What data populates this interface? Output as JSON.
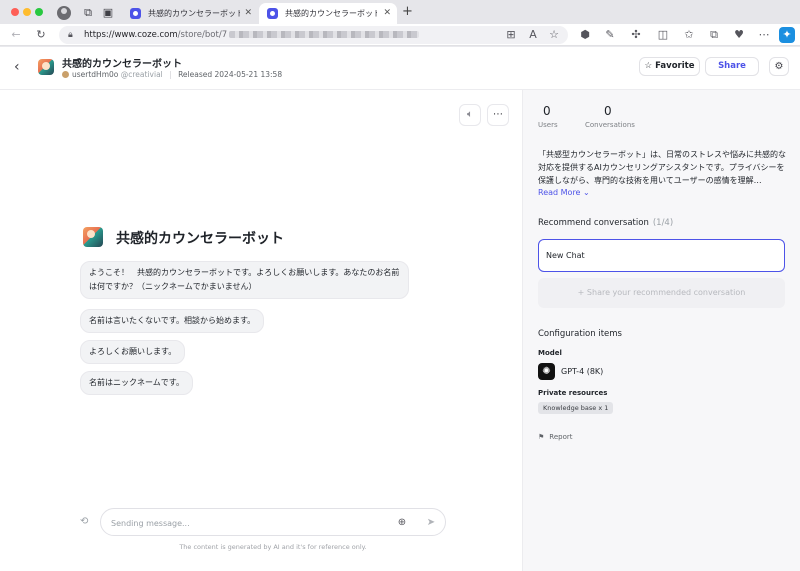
{
  "browser": {
    "tabs": [
      {
        "title": "共感的カウンセラーボット - Publi"
      },
      {
        "title": "共感的カウンセラーボット - Coze"
      }
    ],
    "url_host": "https://www.coze.com",
    "url_path": "/store/bot/7"
  },
  "header": {
    "bot_name": "共感的カウンセラーボット",
    "username": "usertdHm0o",
    "handle": "@creativial",
    "released": "Released 2024-05-21 13:58",
    "favorite_label": "Favorite",
    "share_label": "Share"
  },
  "chat": {
    "bot_name": "共感的カウンセラーボット",
    "greeting": "ようこそ！　共感的カウンセラーボットです。よろしくお願いします。あなたのお名前は何ですか？（ニックネームでかまいません）",
    "suggestions": [
      "名前は言いたくないです。相談から始めます。",
      "よろしくお願いします。",
      "名前はニックネームです。"
    ],
    "input_placeholder": "Sending message...",
    "disclaimer": "The content is generated by AI and it's for reference only."
  },
  "side": {
    "users_count": "0",
    "users_label": "Users",
    "conversations_count": "0",
    "conversations_label": "Conversations",
    "description": "「共感型カウンセラーボット」は、日常のストレスや悩みに共感的な対応を提供するAIカウンセリングアシスタントです。プライバシーを保護しながら、専門的な技術を用いてユーザーの感情を理解…",
    "read_more": "Read More",
    "recommend_title": "Recommend conversation",
    "recommend_count": "(1/4)",
    "new_chat": "New Chat",
    "share_recommended": "+ Share your recommended conversation",
    "config_title": "Configuration items",
    "model_label": "Model",
    "model_name": "GPT-4 (8K)",
    "private_label": "Private resources",
    "kb_badge": "Knowledge base x 1",
    "report": "Report"
  },
  "colors": {
    "accent": "#4d53e8",
    "panel_bg": "#f7f7f9"
  }
}
